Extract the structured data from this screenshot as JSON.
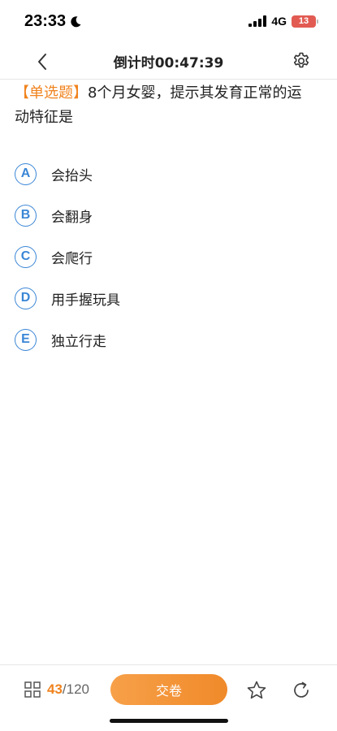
{
  "status": {
    "time": "23:33",
    "network": "4G",
    "battery": "13"
  },
  "nav": {
    "title": "倒计时00:47:39"
  },
  "question": {
    "type_label": "【单选题】",
    "text": "8个月女婴，提示其发育正常的运动特征是"
  },
  "options": [
    {
      "letter": "A",
      "text": "会抬头"
    },
    {
      "letter": "B",
      "text": "会翻身"
    },
    {
      "letter": "C",
      "text": "会爬行"
    },
    {
      "letter": "D",
      "text": "用手握玩具"
    },
    {
      "letter": "E",
      "text": "独立行走"
    }
  ],
  "bottom": {
    "current": "43",
    "total": "/120",
    "submit_label": "交卷"
  },
  "colors": {
    "accent": "#f0831e",
    "option_blue": "#3a86d6",
    "battery_low": "#e25b52"
  }
}
